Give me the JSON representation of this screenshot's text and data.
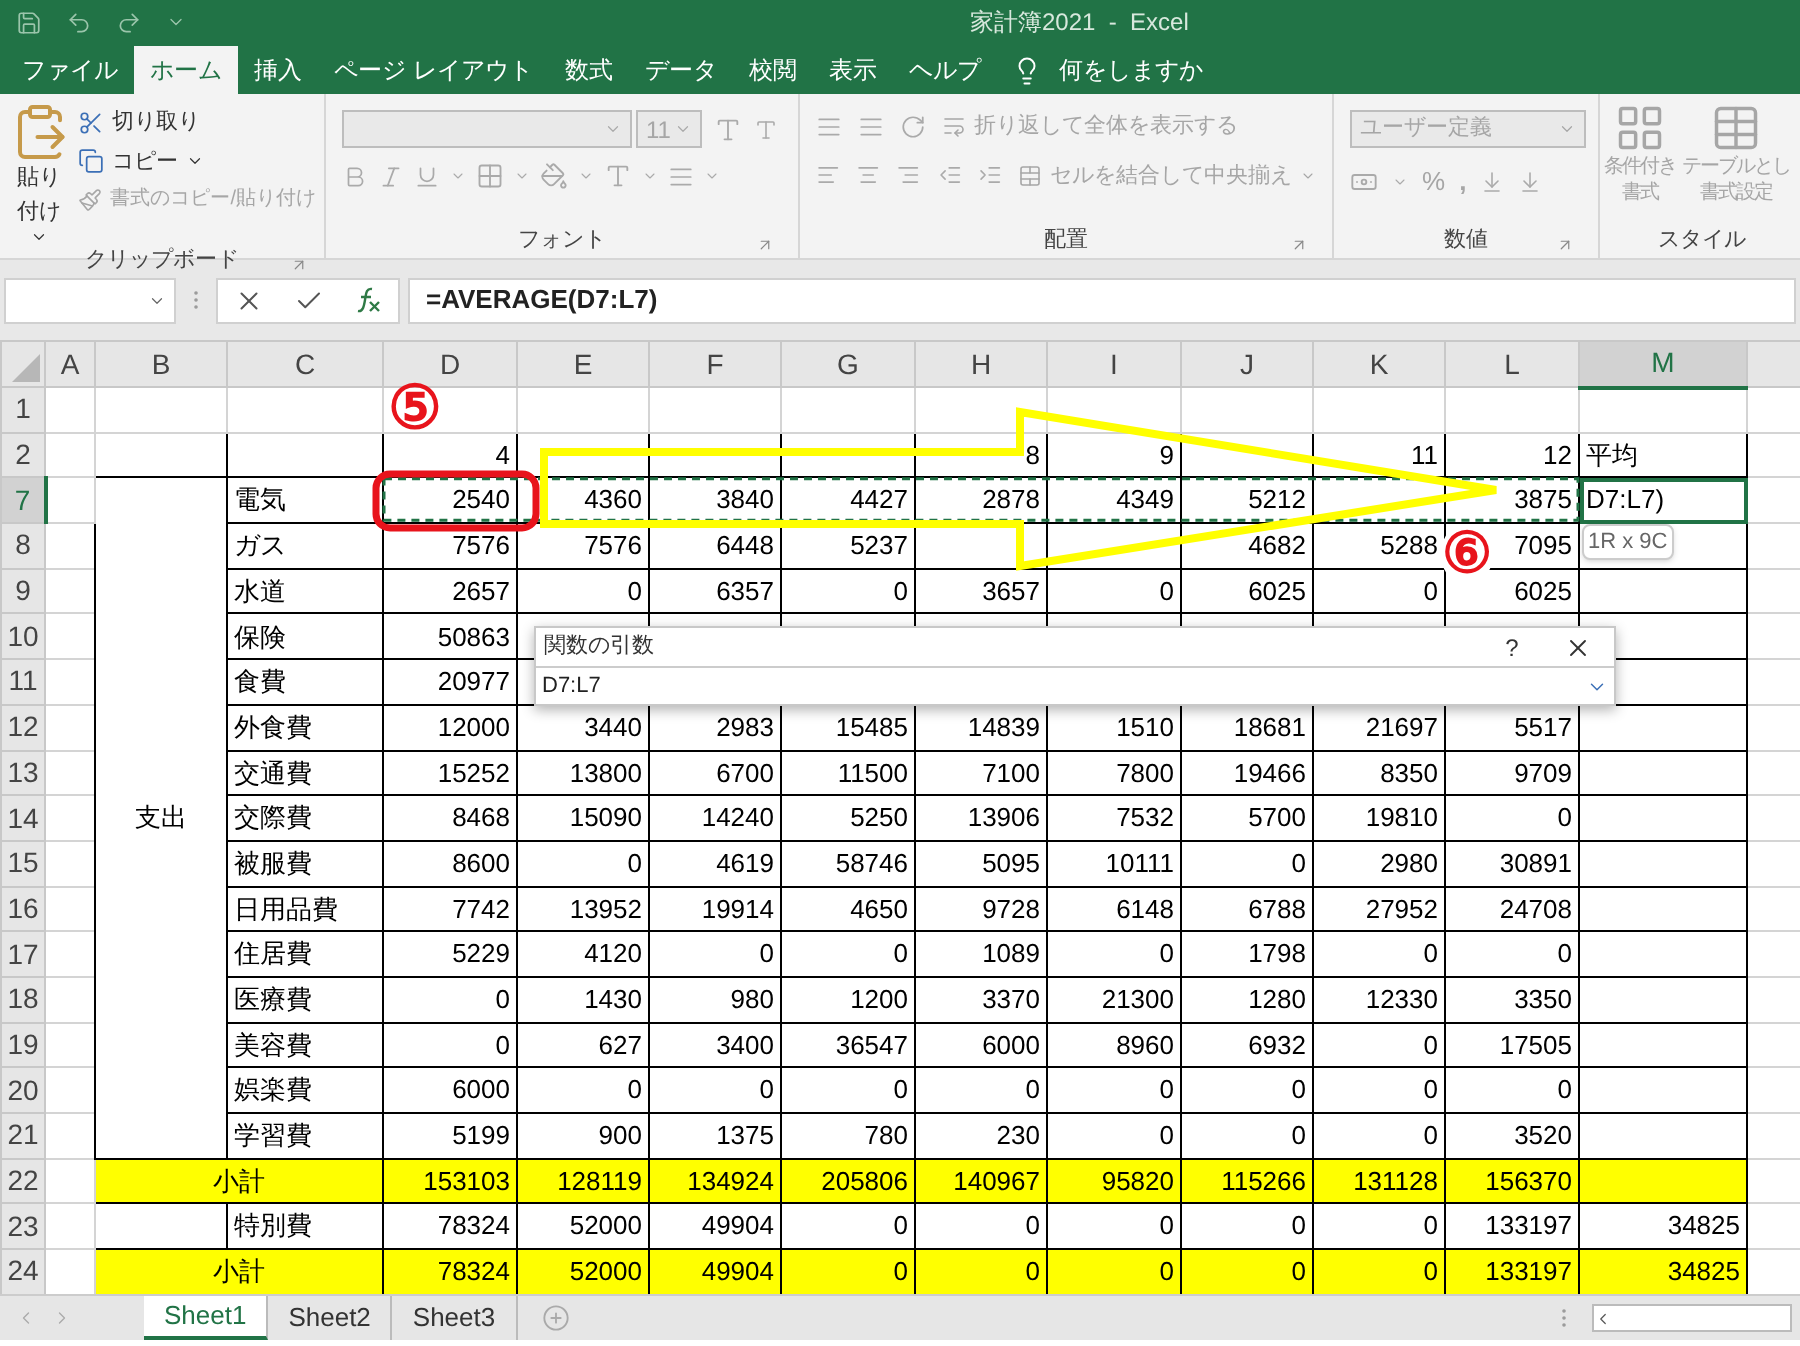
{
  "window": {
    "title": "家計簿2021  -  Excel"
  },
  "ribbon_tabs": [
    {
      "label": "ファイル",
      "selected": false
    },
    {
      "label": "ホーム",
      "selected": true
    },
    {
      "label": "挿入",
      "selected": false
    },
    {
      "label": "ページ レイアウト",
      "selected": false
    },
    {
      "label": "数式",
      "selected": false
    },
    {
      "label": "データ",
      "selected": false
    },
    {
      "label": "校閲",
      "selected": false
    },
    {
      "label": "表示",
      "selected": false
    },
    {
      "label": "ヘルプ",
      "selected": false
    }
  ],
  "tell_me": {
    "placeholder": "何をしますか"
  },
  "clipboard": {
    "paste": "貼り付け",
    "cut": "切り取り",
    "copy": "コピー",
    "format_painter": "書式のコピー/貼り付け",
    "format_painter_disabled": true,
    "group": "クリップボード"
  },
  "font": {
    "size": "11",
    "disabled": true,
    "group": "フォント"
  },
  "alignment": {
    "wrap": "折り返して全体を表示する",
    "merge": "セルを結合して中央揃え",
    "disabled": true,
    "group": "配置"
  },
  "number": {
    "format": "ユーザー定義",
    "percent": "%",
    "comma": ",",
    "disabled": true,
    "group": "数値"
  },
  "styles": {
    "conditional": [
      "条件付き",
      "書式"
    ],
    "table": [
      "テーブルとし",
      "書式設定"
    ],
    "disabled": true,
    "group": "スタイル"
  },
  "formula_bar": {
    "formula": "=AVERAGE(D7:L7)"
  },
  "columns": [
    {
      "label": "A",
      "selected": false
    },
    {
      "label": "B",
      "selected": false
    },
    {
      "label": "C",
      "selected": false
    },
    {
      "label": "D",
      "selected": false
    },
    {
      "label": "E",
      "selected": false
    },
    {
      "label": "F",
      "selected": false
    },
    {
      "label": "G",
      "selected": false
    },
    {
      "label": "H",
      "selected": false
    },
    {
      "label": "I",
      "selected": false
    },
    {
      "label": "J",
      "selected": false
    },
    {
      "label": "K",
      "selected": false
    },
    {
      "label": "L",
      "selected": false
    },
    {
      "label": "M",
      "selected": true
    }
  ],
  "expense_group": "支出",
  "rows": [
    {
      "number": "1",
      "kind": "blank",
      "selected": false
    },
    {
      "number": "2",
      "kind": "header",
      "selected": false,
      "values": {
        "D": "4",
        "H": "8",
        "I": "9",
        "K": "11",
        "L": "12"
      },
      "average": "平均"
    },
    {
      "number": "7",
      "kind": "item",
      "selected": true,
      "label": "電気",
      "values": {
        "D": "2540",
        "E": "4360",
        "F": "3840",
        "G": "4427",
        "H": "2878",
        "I": "4349",
        "J": "5212",
        "L": "3875"
      },
      "average": "D7:L7)"
    },
    {
      "number": "8",
      "kind": "item",
      "selected": false,
      "label": "ガス",
      "values": {
        "D": "7576",
        "E": "7576",
        "F": "6448",
        "G": "5237",
        "J": "4682",
        "K": "5288",
        "L": "7095"
      }
    },
    {
      "number": "9",
      "kind": "item",
      "selected": false,
      "label": "水道",
      "values": {
        "D": "2657",
        "E": "0",
        "F": "6357",
        "G": "0",
        "H": "3657",
        "I": "0",
        "J": "6025",
        "K": "0",
        "L": "6025"
      }
    },
    {
      "number": "10",
      "kind": "item",
      "selected": false,
      "label": "保険",
      "values": {
        "D": "50863"
      }
    },
    {
      "number": "11",
      "kind": "item",
      "selected": false,
      "label": "食費",
      "values": {
        "D": "20977"
      }
    },
    {
      "number": "12",
      "kind": "item",
      "selected": false,
      "label": "外食費",
      "values": {
        "D": "12000",
        "E": "3440",
        "F": "2983",
        "G": "15485",
        "H": "14839",
        "I": "1510",
        "J": "18681",
        "K": "21697",
        "L": "5517"
      }
    },
    {
      "number": "13",
      "kind": "item",
      "selected": false,
      "label": "交通費",
      "values": {
        "D": "15252",
        "E": "13800",
        "F": "6700",
        "G": "11500",
        "H": "7100",
        "I": "7800",
        "J": "19466",
        "K": "8350",
        "L": "9709"
      }
    },
    {
      "number": "14",
      "kind": "item",
      "selected": false,
      "label": "交際費",
      "values": {
        "D": "8468",
        "E": "15090",
        "F": "14240",
        "G": "5250",
        "H": "13906",
        "I": "7532",
        "J": "5700",
        "K": "19810",
        "L": "0"
      }
    },
    {
      "number": "15",
      "kind": "item",
      "selected": false,
      "label": "被服費",
      "values": {
        "D": "8600",
        "E": "0",
        "F": "4619",
        "G": "58746",
        "H": "5095",
        "I": "10111",
        "J": "0",
        "K": "2980",
        "L": "30891"
      }
    },
    {
      "number": "16",
      "kind": "item",
      "selected": false,
      "label": "日用品費",
      "values": {
        "D": "7742",
        "E": "13952",
        "F": "19914",
        "G": "4650",
        "H": "9728",
        "I": "6148",
        "J": "6788",
        "K": "27952",
        "L": "24708"
      }
    },
    {
      "number": "17",
      "kind": "item",
      "selected": false,
      "label": "住居費",
      "values": {
        "D": "5229",
        "E": "4120",
        "F": "0",
        "G": "0",
        "H": "1089",
        "I": "0",
        "J": "1798",
        "K": "0",
        "L": "0"
      }
    },
    {
      "number": "18",
      "kind": "item",
      "selected": false,
      "label": "医療費",
      "values": {
        "D": "0",
        "E": "1430",
        "F": "980",
        "G": "1200",
        "H": "3370",
        "I": "21300",
        "J": "1280",
        "K": "12330",
        "L": "3350"
      }
    },
    {
      "number": "19",
      "kind": "item",
      "selected": false,
      "label": "美容費",
      "values": {
        "D": "0",
        "E": "627",
        "F": "3400",
        "G": "36547",
        "H": "6000",
        "I": "8960",
        "J": "6932",
        "K": "0",
        "L": "17505"
      }
    },
    {
      "number": "20",
      "kind": "item",
      "selected": false,
      "label": "娯楽費",
      "values": {
        "D": "6000",
        "E": "0",
        "F": "0",
        "G": "0",
        "H": "0",
        "I": "0",
        "J": "0",
        "K": "0",
        "L": "0"
      }
    },
    {
      "number": "21",
      "kind": "item",
      "selected": false,
      "label": "学習費",
      "values": {
        "D": "5199",
        "E": "900",
        "F": "1375",
        "G": "780",
        "H": "230",
        "I": "0",
        "J": "0",
        "K": "0",
        "L": "3520"
      }
    },
    {
      "number": "22",
      "kind": "subtotal",
      "selected": false,
      "label": "小計",
      "values": {
        "D": "153103",
        "E": "128119",
        "F": "134924",
        "G": "205806",
        "H": "140967",
        "I": "95820",
        "J": "115266",
        "K": "131128",
        "L": "156370"
      }
    },
    {
      "number": "23",
      "kind": "extra",
      "selected": false,
      "label": "特別費",
      "values": {
        "D": "78324",
        "E": "52000",
        "F": "49904",
        "G": "0",
        "H": "0",
        "I": "0",
        "J": "0",
        "K": "0",
        "L": "133197"
      },
      "average": "34825"
    },
    {
      "number": "24",
      "kind": "subtotal",
      "selected": false,
      "label": "小計",
      "values": {
        "D": "78324",
        "E": "52000",
        "F": "49904",
        "G": "0",
        "H": "0",
        "I": "0",
        "J": "0",
        "K": "0",
        "L": "133197"
      },
      "average": "34825"
    }
  ],
  "dialog": {
    "title": "関数の引数",
    "help": "?",
    "value": "D7:L7"
  },
  "range_tip": "1R x 9C",
  "callouts": [
    "⑤",
    "⑥"
  ],
  "sheets": [
    {
      "label": "Sheet1",
      "selected": true
    },
    {
      "label": "Sheet2",
      "selected": false
    },
    {
      "label": "Sheet3",
      "selected": false
    }
  ]
}
